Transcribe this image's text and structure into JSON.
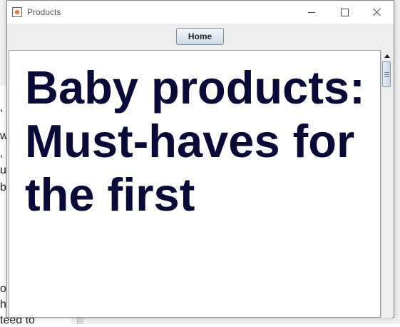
{
  "background_window": {
    "fragments": [
      ",",
      "w",
      ", ",
      "uc",
      "b",
      "o",
      "h",
      "teed to"
    ]
  },
  "window": {
    "title": "Products",
    "icon": "java-cup-icon",
    "controls": {
      "minimize_icon": "minimize-icon",
      "maximize_icon": "maximize-icon",
      "close_icon": "close-icon"
    }
  },
  "toolbar": {
    "home_label": "Home"
  },
  "content": {
    "headline": "Baby products: Must-haves for the first"
  },
  "colors": {
    "headline": "#0a0a3a",
    "button_gradient_top": "#f3f7fb",
    "button_gradient_bottom": "#cfdbe7"
  }
}
